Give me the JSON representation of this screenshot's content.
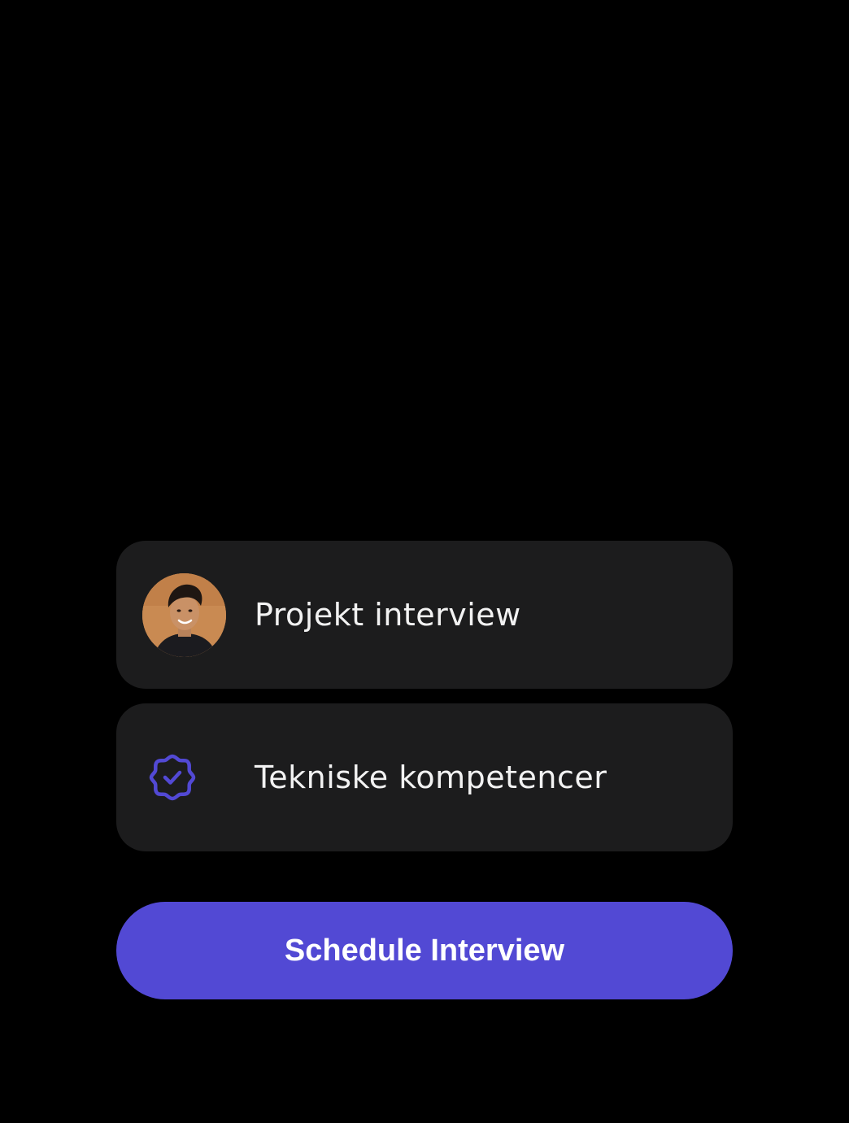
{
  "cards": [
    {
      "label": "Projekt interview",
      "icon": "avatar-photo"
    },
    {
      "label": "Tekniske kompetencer",
      "icon": "verified-badge-icon"
    }
  ],
  "cta": {
    "label": "Schedule Interview"
  },
  "colors": {
    "background": "#000000",
    "card": "#1c1c1d",
    "accent": "#5249d4",
    "text": "#f2f2f2"
  }
}
